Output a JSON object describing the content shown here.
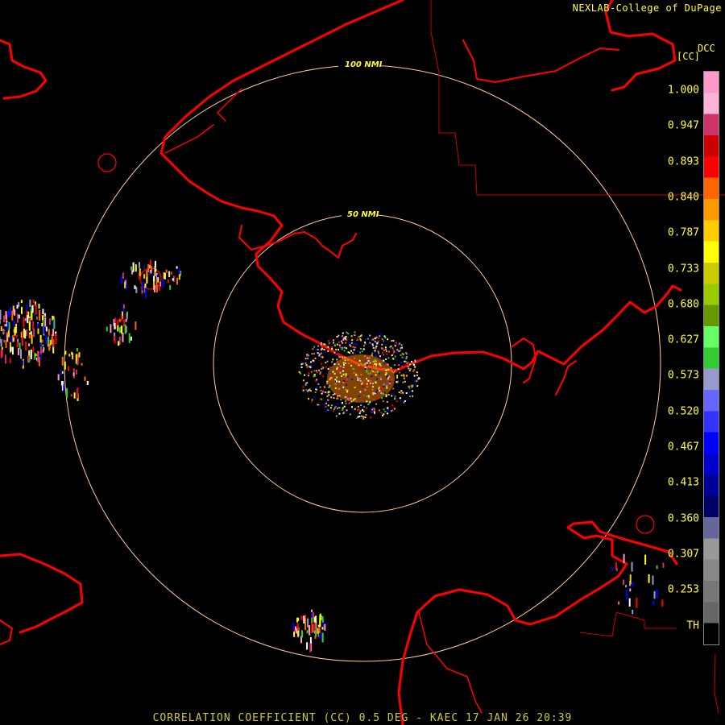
{
  "credit": "NEXLAB-College of DuPage",
  "bottom_title": "CORRELATION COEFFICIENT (CC) 0.5 DEG - KAEC 17 JAN 26 20:39",
  "ring_labels": {
    "inner": "50 NMI",
    "outer": "100 NMI"
  },
  "colorbar": {
    "product": "DCC",
    "unit": "[CC]",
    "ticks": [
      "1.000",
      "0.947",
      "0.893",
      "0.840",
      "0.787",
      "0.733",
      "0.680",
      "0.627",
      "0.573",
      "0.520",
      "0.467",
      "0.413",
      "0.360",
      "0.307",
      "0.253",
      "TH"
    ],
    "colors": [
      "#ff99cc",
      "#ffb3d9",
      "#cc3366",
      "#cc0000",
      "#ff0000",
      "#ff6600",
      "#ff9900",
      "#ffcc00",
      "#ffff00",
      "#cccc00",
      "#99cc00",
      "#669900",
      "#66ff66",
      "#33cc33",
      "#9999cc",
      "#6666ff",
      "#3333ff",
      "#0000ff",
      "#0000cc",
      "#000099",
      "#000066",
      "#666699",
      "#999999",
      "#888888",
      "#777777",
      "#666666",
      "#000000"
    ]
  },
  "colors": {
    "coast": "#ff0000",
    "ring": "#ffcc99",
    "boundary": "#cc0000",
    "text": "#ffff33"
  }
}
